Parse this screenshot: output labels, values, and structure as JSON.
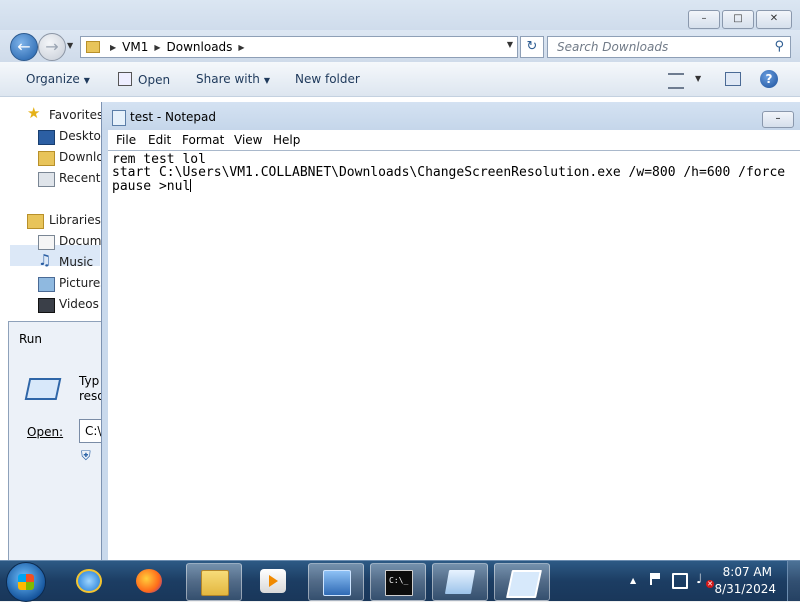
{
  "explorer": {
    "breadcrumb": [
      "VM1",
      "Downloads"
    ],
    "search_placeholder": "Search Downloads",
    "toolbar": {
      "organize": "Organize",
      "open": "Open",
      "share_with": "Share with",
      "new_folder": "New folder"
    },
    "nav": {
      "favorites": "Favorites",
      "desktop": "Desktop",
      "downloads": "Downlo",
      "recent": "Recent P",
      "libraries": "Libraries",
      "documents": "Docume",
      "music": "Music",
      "pictures": "Pictures",
      "videos": "Videos"
    }
  },
  "run_dialog": {
    "title": "Run",
    "text_line1": "Typ",
    "text_line2": "reso",
    "open_label": "Open:",
    "input_value": "C:\\"
  },
  "notepad": {
    "title": "test - Notepad",
    "menu": [
      "File",
      "Edit",
      "Format",
      "View",
      "Help"
    ],
    "lines": [
      "rem test lol",
      "start C:\\Users\\VM1.COLLABNET\\Downloads\\ChangeScreenResolution.exe /w=800 /h=600 /force",
      "pause >nul"
    ]
  },
  "taskbar": {
    "icons": [
      "start-icon",
      "internet-explorer-icon",
      "firefox-icon",
      "windows-explorer-icon",
      "media-player-icon",
      "control-panel-icon",
      "command-prompt-icon",
      "notepad-icon",
      "run-icon"
    ],
    "clock_time": "8:07 AM",
    "clock_date": "8/31/2024"
  },
  "colors": {
    "taskbar": "#1c3d63",
    "window_chrome": "#cfdcec",
    "selection": "#dce8f7"
  }
}
